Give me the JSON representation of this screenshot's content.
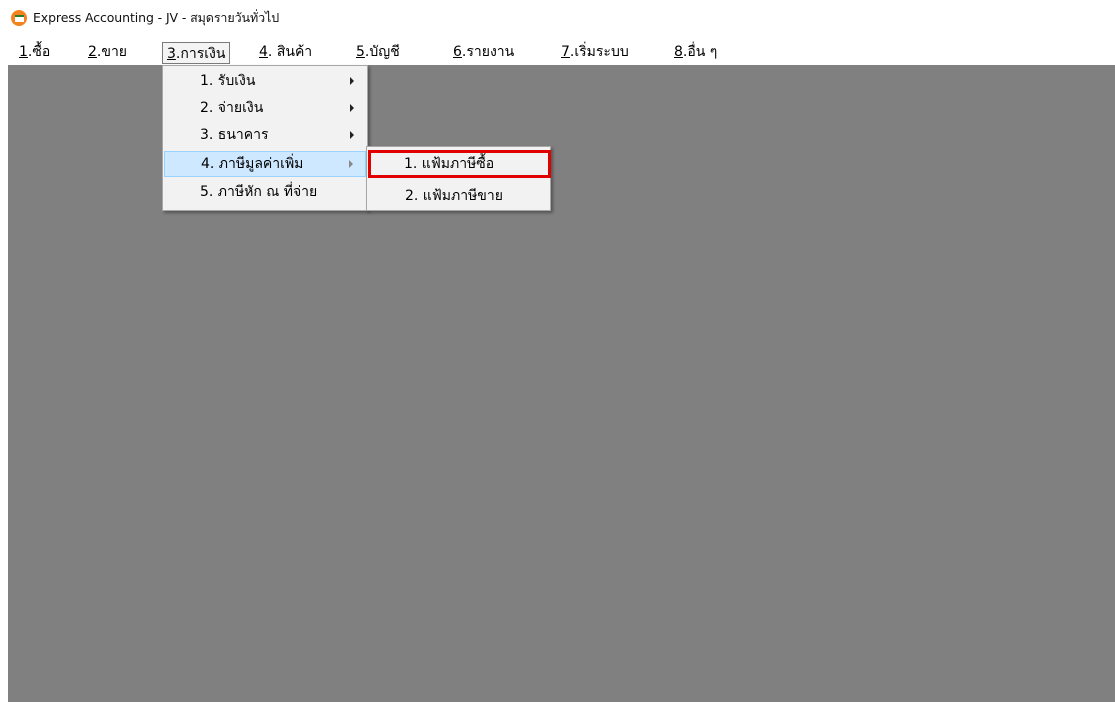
{
  "window": {
    "title": "Express Accounting - JV - สมุดรายวันทั่วไป"
  },
  "menubar": {
    "items": [
      {
        "num": "1",
        "label": ".ซื้อ"
      },
      {
        "num": "2",
        "label": ".ขาย"
      },
      {
        "num": "3",
        "label": ".การเงิน"
      },
      {
        "num": "4",
        "label": ". สินค้า"
      },
      {
        "num": "5",
        "label": ".บัญชี"
      },
      {
        "num": "6",
        "label": ".รายงาน"
      },
      {
        "num": "7",
        "label": ".เริ่มระบบ"
      },
      {
        "num": "8",
        "label": ".อื่น ๆ"
      }
    ]
  },
  "finance_menu": {
    "items": [
      {
        "label": "1. รับเงิน"
      },
      {
        "label": "2. จ่ายเงิน"
      },
      {
        "label": "3. ธนาคาร"
      },
      {
        "label": "4. ภาษีมูลค่าเพิ่ม"
      },
      {
        "label": "5. ภาษีหัก ณ ที่จ่าย"
      }
    ]
  },
  "vat_submenu": {
    "items": [
      {
        "label": "1. แฟ้มภาษีซื้อ"
      },
      {
        "label": "2. แฟ้มภาษีขาย"
      }
    ]
  },
  "colors": {
    "workspace": "#808080",
    "highlight": "#cde8ff",
    "selection_box": "#e00000"
  },
  "icons": {
    "app": "express-logo-icon",
    "submenu_arrow": "triangle-right-icon"
  }
}
